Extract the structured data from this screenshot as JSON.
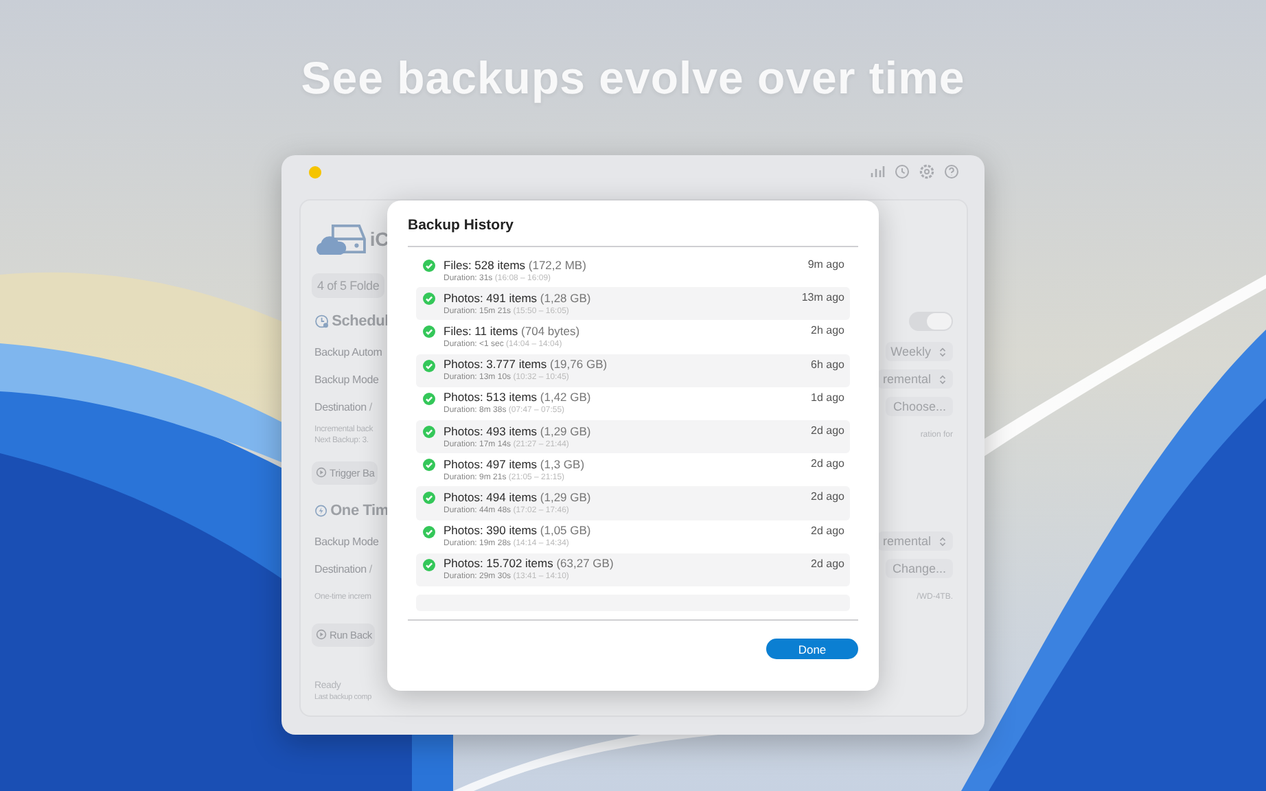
{
  "headline": "See backups evolve over time",
  "window": {
    "rows": [
      {
        "left": {
          "kind": "app",
          "text": "iC"
        }
      },
      {
        "left": {
          "kind": "pill",
          "text": "4 of 5 Folde"
        }
      },
      {
        "left": {
          "kind": "timed",
          "text": "Schedul"
        },
        "right": {
          "kind": "toggle",
          "on": true
        }
      },
      {
        "left": {
          "kind": "label",
          "text": "Backup Autom"
        },
        "right": {
          "kind": "select",
          "text": "Weekly"
        }
      },
      {
        "left": {
          "kind": "label",
          "text": "Backup Mode"
        },
        "right": {
          "kind": "select",
          "text": "remental"
        }
      },
      {
        "left": {
          "kind": "label",
          "text": "Destination",
          "path": "/"
        },
        "right": {
          "kind": "button",
          "text": "Choose..."
        }
      },
      {
        "left": {
          "kind": "note",
          "lines": [
            "Incremental back",
            "Next Backup: 3."
          ]
        },
        "right": {
          "kind": "note",
          "lines": [
            "ration for"
          ]
        }
      },
      {
        "left": {
          "kind": "action",
          "text": "Trigger Ba"
        }
      },
      {
        "left": {
          "kind": "instant",
          "text": "One Tim"
        }
      },
      {
        "left": {
          "kind": "label",
          "text": "Backup Mode"
        },
        "right": {
          "kind": "select",
          "text": "remental"
        }
      },
      {
        "left": {
          "kind": "label",
          "text": "Destination",
          "path": "/"
        },
        "right": {
          "kind": "button",
          "text": "Change..."
        }
      },
      {
        "left": {
          "kind": "note",
          "lines": [
            "One-time increm"
          ]
        },
        "right": {
          "kind": "note",
          "lines": [
            "/WD-4TB."
          ]
        }
      },
      {
        "left": {
          "kind": "action",
          "text": "Run Back"
        }
      },
      {
        "left": {
          "kind": "status",
          "lines": [
            "Ready",
            "Last backup comp"
          ]
        }
      }
    ]
  },
  "dialog": {
    "title": "Backup History",
    "done_button": "Done",
    "entries": [
      {
        "title": "Files: 528 items",
        "size": "(172,2 MB)",
        "duration": "Duration: 31s",
        "span": "(16:08 – 16:09)",
        "ago": "9m ago"
      },
      {
        "title": "Photos: 491 items",
        "size": "(1,28 GB)",
        "duration": "Duration: 15m 21s",
        "span": "(15:50 – 16:05)",
        "ago": "13m ago"
      },
      {
        "title": "Files: 11 items",
        "size": "(704 bytes)",
        "duration": "Duration: <1 sec",
        "span": "(14:04 – 14:04)",
        "ago": "2h ago"
      },
      {
        "title": "Photos: 3.777 items",
        "size": "(19,76 GB)",
        "duration": "Duration: 13m 10s",
        "span": "(10:32 – 10:45)",
        "ago": "6h ago"
      },
      {
        "title": "Photos: 513 items",
        "size": "(1,42 GB)",
        "duration": "Duration: 8m 38s",
        "span": "(07:47 – 07:55)",
        "ago": "1d ago"
      },
      {
        "title": "Photos: 493 items",
        "size": "(1,29 GB)",
        "duration": "Duration: 17m 14s",
        "span": "(21:27 – 21:44)",
        "ago": "2d ago"
      },
      {
        "title": "Photos: 497 items",
        "size": "(1,3 GB)",
        "duration": "Duration: 9m 21s",
        "span": "(21:05 – 21:15)",
        "ago": "2d ago"
      },
      {
        "title": "Photos: 494 items",
        "size": "(1,29 GB)",
        "duration": "Duration: 44m 48s",
        "span": "(17:02 – 17:46)",
        "ago": "2d ago"
      },
      {
        "title": "Photos: 390 items",
        "size": "(1,05 GB)",
        "duration": "Duration: 19m 28s",
        "span": "(14:14 – 14:34)",
        "ago": "2d ago"
      },
      {
        "title": "Photos: 15.702 items",
        "size": "(63,27 GB)",
        "duration": "Duration: 29m 30s",
        "span": "(13:41 – 14:10)",
        "ago": "2d ago"
      }
    ]
  }
}
